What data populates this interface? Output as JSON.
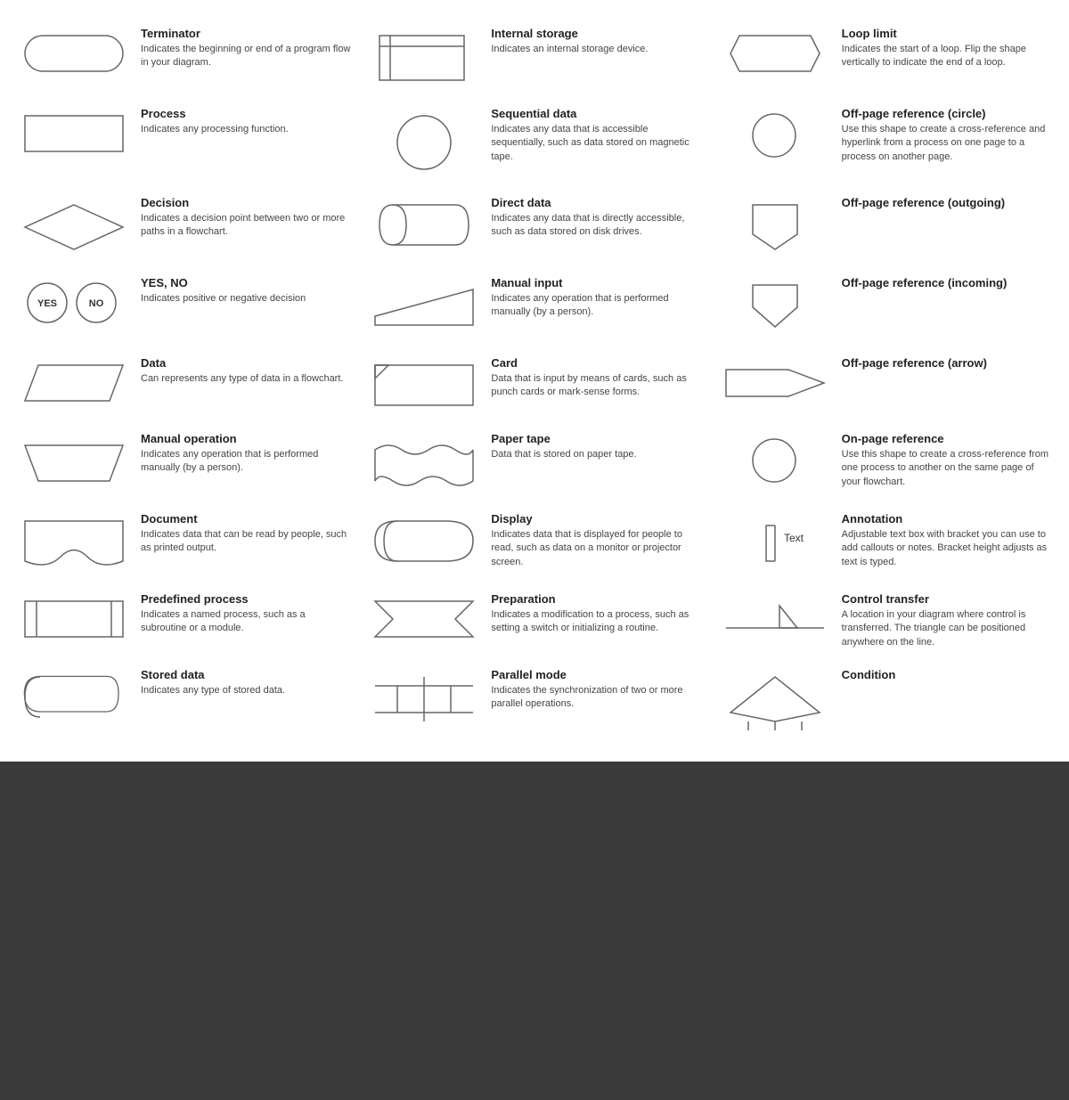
{
  "items": [
    {
      "id": "terminator",
      "title": "Terminator",
      "desc": "Indicates the beginning or end of a program flow in your diagram.",
      "shape": "terminator",
      "col": 0
    },
    {
      "id": "internal-storage",
      "title": "Internal storage",
      "desc": "Indicates an internal storage device.",
      "shape": "internal-storage",
      "col": 1
    },
    {
      "id": "loop-limit",
      "title": "Loop limit",
      "desc": "Indicates the start of a loop. Flip the shape vertically to indicate the end of a loop.",
      "shape": "loop-limit",
      "col": 2
    },
    {
      "id": "process",
      "title": "Process",
      "desc": "Indicates any processing function.",
      "shape": "process",
      "col": 0
    },
    {
      "id": "sequential-data",
      "title": "Sequential data",
      "desc": "Indicates any data that is accessible sequentially, such as data stored on magnetic tape.",
      "shape": "sequential-data",
      "col": 1
    },
    {
      "id": "off-page-circle",
      "title": "Off-page reference (circle)",
      "desc": "Use this shape to create a cross-reference and hyperlink from a process on one page to a process on another page.",
      "shape": "off-page-circle",
      "col": 2
    },
    {
      "id": "decision",
      "title": "Decision",
      "desc": "Indicates a decision point between two or more paths in a flowchart.",
      "shape": "decision",
      "col": 0
    },
    {
      "id": "direct-data",
      "title": "Direct data",
      "desc": "Indicates any data that is directly accessible, such as data stored on disk drives.",
      "shape": "direct-data",
      "col": 1
    },
    {
      "id": "off-page-outgoing",
      "title": "Off-page reference (outgoing)",
      "desc": "",
      "shape": "off-page-outgoing",
      "col": 2
    },
    {
      "id": "yes-no",
      "title": "YES, NO",
      "desc": "Indicates positive or negative decision",
      "shape": "yes-no",
      "col": 0
    },
    {
      "id": "manual-input",
      "title": "Manual input",
      "desc": "Indicates any operation that is performed manually (by a person).",
      "shape": "manual-input",
      "col": 1
    },
    {
      "id": "off-page-incoming",
      "title": "Off-page reference (incoming)",
      "desc": "",
      "shape": "off-page-incoming",
      "col": 2
    },
    {
      "id": "data",
      "title": "Data",
      "desc": "Can represents any type of data in a flowchart.",
      "shape": "data",
      "col": 0
    },
    {
      "id": "card",
      "title": "Card",
      "desc": "Data that is input by means of cards, such as punch cards or mark-sense forms.",
      "shape": "card",
      "col": 1
    },
    {
      "id": "off-page-arrow",
      "title": "Off-page reference (arrow)",
      "desc": "",
      "shape": "off-page-arrow",
      "col": 2
    },
    {
      "id": "manual-operation",
      "title": "Manual operation",
      "desc": "Indicates any operation that is performed manually (by a person).",
      "shape": "manual-operation",
      "col": 0
    },
    {
      "id": "paper-tape",
      "title": "Paper tape",
      "desc": "Data that is stored on paper tape.",
      "shape": "paper-tape",
      "col": 1
    },
    {
      "id": "on-page-reference",
      "title": "On-page reference",
      "desc": "Use this shape to create a cross-reference from one process to another on the same page of your flowchart.",
      "shape": "on-page-reference",
      "col": 2
    },
    {
      "id": "document",
      "title": "Document",
      "desc": "Indicates data that can be read by people, such as printed output.",
      "shape": "document",
      "col": 0
    },
    {
      "id": "display",
      "title": "Display",
      "desc": "Indicates data that is displayed for people to read, such as data on a monitor or projector screen.",
      "shape": "display",
      "col": 1
    },
    {
      "id": "annotation",
      "title": "Annotation",
      "desc": "Adjustable text box with bracket you can use to add callouts or notes. Bracket height adjusts as text is typed.",
      "shape": "annotation",
      "col": 2
    },
    {
      "id": "predefined-process",
      "title": "Predefined process",
      "desc": "Indicates a named process, such as a subroutine or a module.",
      "shape": "predefined-process",
      "col": 0
    },
    {
      "id": "preparation",
      "title": "Preparation",
      "desc": "Indicates a modification to a process, such as setting a switch or initializing a routine.",
      "shape": "preparation",
      "col": 1
    },
    {
      "id": "control-transfer",
      "title": "Control transfer",
      "desc": "A location in your diagram where control is transferred. The triangle can be positioned anywhere on the line.",
      "shape": "control-transfer",
      "col": 2
    },
    {
      "id": "stored-data",
      "title": "Stored data",
      "desc": "Indicates any type of stored data.",
      "shape": "stored-data",
      "col": 0
    },
    {
      "id": "parallel-mode",
      "title": "Parallel mode",
      "desc": "Indicates the synchronization of two or more parallel operations.",
      "shape": "parallel-mode",
      "col": 1
    },
    {
      "id": "condition",
      "title": "Condition",
      "desc": "",
      "shape": "condition",
      "col": 2
    }
  ]
}
